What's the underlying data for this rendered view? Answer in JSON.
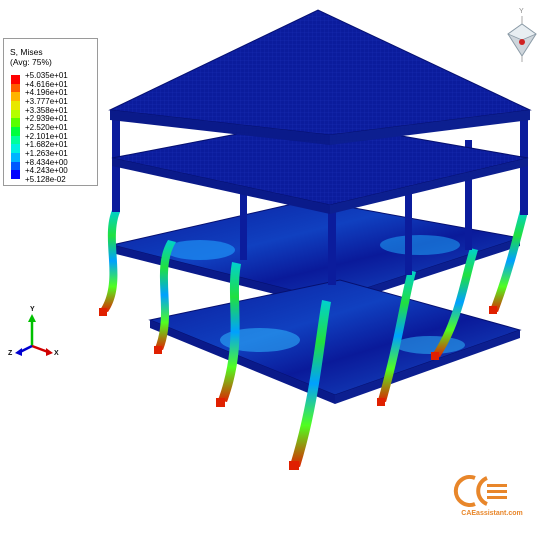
{
  "legend": {
    "title": "S, Mises",
    "subtitle": "(Avg: 75%)",
    "values": [
      "+5.035e+01",
      "+4.616e+01",
      "+4.196e+01",
      "+3.777e+01",
      "+3.358e+01",
      "+2.939e+01",
      "+2.520e+01",
      "+2.101e+01",
      "+1.682e+01",
      "+1.263e+01",
      "+8.434e+00",
      "+4.243e+00",
      "+5.128e-02"
    ],
    "colors": [
      "#ff0000",
      "#ff5a00",
      "#ffb400",
      "#e8e800",
      "#b4ff00",
      "#5aff00",
      "#00ff3c",
      "#00ff9c",
      "#00f0e0",
      "#00b4ff",
      "#005aff",
      "#0000ff"
    ]
  },
  "triad": {
    "y_label": "Y",
    "z_label": "Z",
    "x_label": "X"
  },
  "view_cube": {
    "label": "Y"
  },
  "watermark": {
    "text": "CAEassistant.com",
    "accent": "#e8862a"
  },
  "model": {
    "description_colors": {
      "base": "#0a1a9a",
      "high": "#ff2000"
    }
  }
}
